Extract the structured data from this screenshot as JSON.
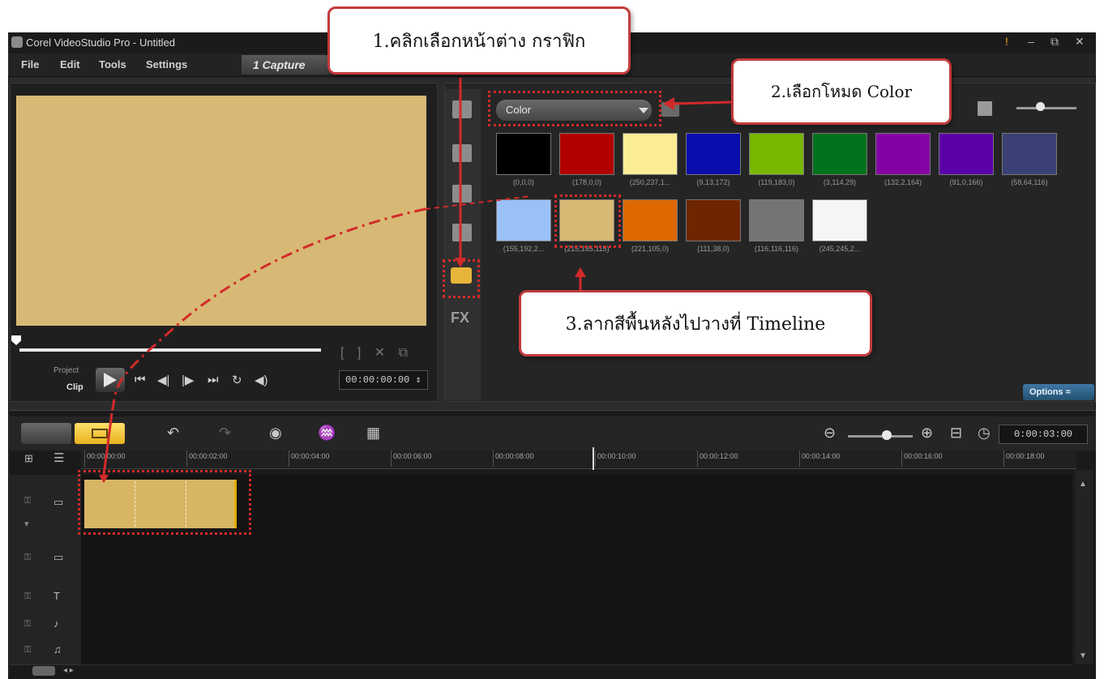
{
  "window": {
    "title": "Corel VideoStudio Pro - Untitled",
    "controls": [
      "!",
      "–",
      "⧉",
      "✕"
    ]
  },
  "menu": {
    "items": [
      "File",
      "Edit",
      "Tools",
      "Settings"
    ],
    "capture_tab": "1 Capture"
  },
  "player": {
    "project_label": "Project",
    "clip_label": "Clip",
    "timecode": "00:00:00:00 ⇕",
    "trim_icons": "[ ] ✕ ⧉",
    "controls": [
      "⏮",
      "◀|",
      "|▶",
      "⏭",
      "↻",
      "◀)"
    ]
  },
  "library": {
    "dropdown_value": "Color",
    "options_button": "Options ≈",
    "side_fx_label": "FX",
    "swatches": [
      {
        "label": "(0,0,0)",
        "color": "#000000"
      },
      {
        "label": "(178,0,0)",
        "color": "#b20000"
      },
      {
        "label": "(250,237,1...",
        "color": "#faed96"
      },
      {
        "label": "(9,13,172)",
        "color": "#090dac"
      },
      {
        "label": "(119,183,0)",
        "color": "#77b700"
      },
      {
        "label": "(3,114,29)",
        "color": "#03721d"
      },
      {
        "label": "(132,2,164)",
        "color": "#8402a4"
      },
      {
        "label": "(91,0,166)",
        "color": "#5b00a6"
      },
      {
        "label": "(58,64,116)",
        "color": "#3a4074"
      },
      {
        "label": "(155,192,2...",
        "color": "#9bc0f8"
      },
      {
        "label": "(215,185,115)",
        "color": "#d7b973"
      },
      {
        "label": "(221,105,0)",
        "color": "#dd6900"
      },
      {
        "label": "(111,38,0)",
        "color": "#6f2600"
      },
      {
        "label": "(116,116,116)",
        "color": "#747474"
      },
      {
        "label": "(245,245,2...",
        "color": "#f5f5f5"
      }
    ]
  },
  "timeline": {
    "duration": "0:00:03:00",
    "ruler_labels": [
      "00:00:00:00",
      "00:00:02:00",
      "00:00:04:00",
      "00:00:06:00",
      "00:00:08:00",
      "00:00:10:00",
      "00:00:12:00",
      "00:00:14:00",
      "00:00:16:00",
      "00:00:18:00"
    ],
    "clip_color": "#d8b565"
  },
  "annotations": {
    "step1": "1.คลิกเลือกหน้าต่าง กราฟิก",
    "step2": "2.เลือกโหมด Color",
    "step3": "3.ลากสีพื้นหลังไปวางที่ Timeline"
  },
  "colors": {
    "preview": "#d7b975",
    "callout_border": "#c33b3b",
    "accent_yellow": "#e7b21e"
  }
}
